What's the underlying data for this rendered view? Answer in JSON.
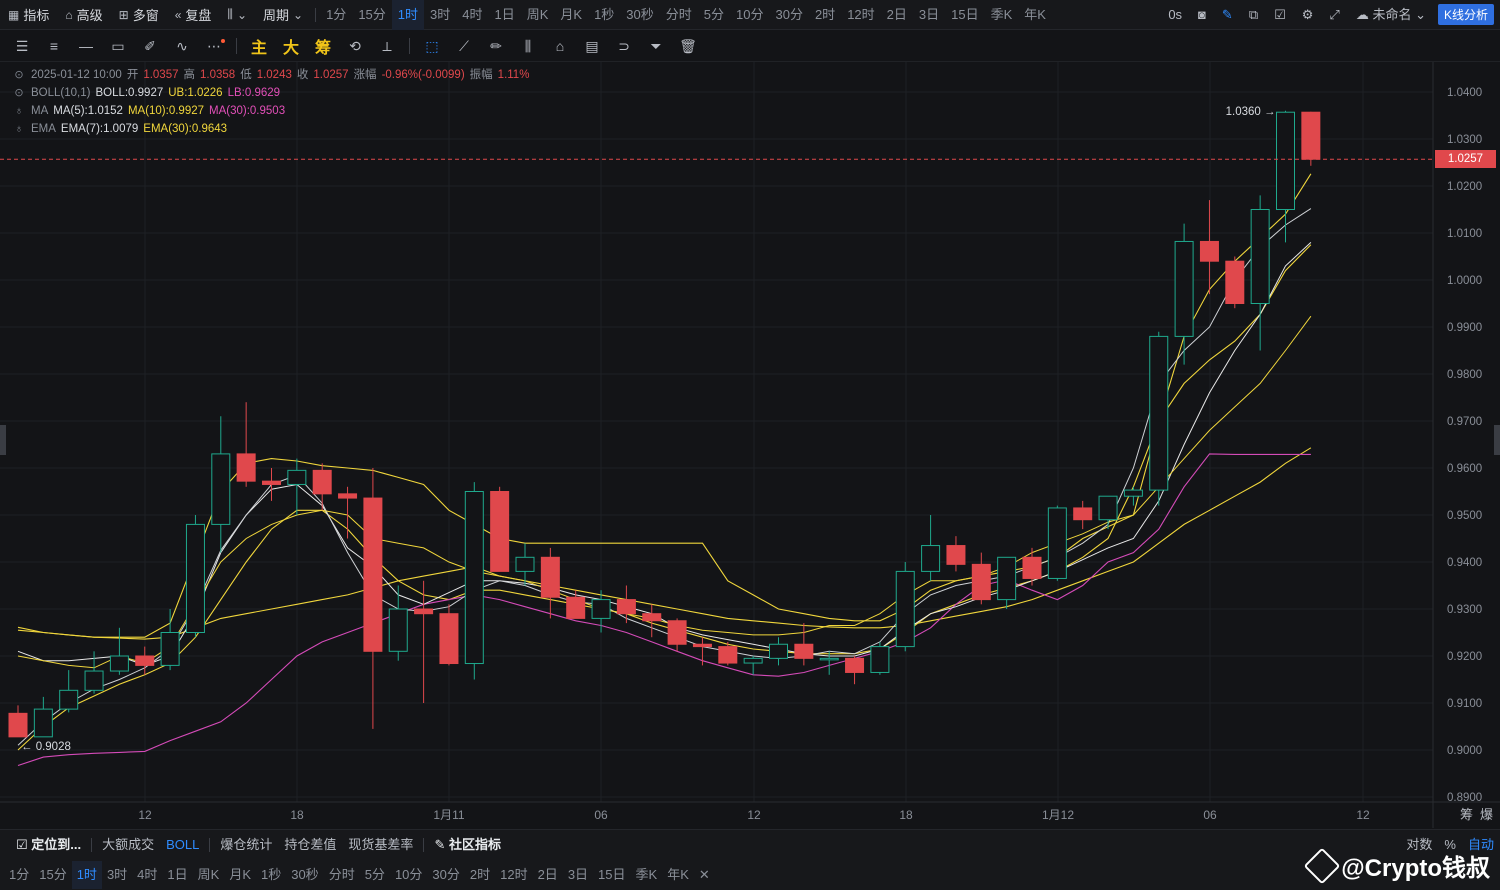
{
  "topbar": {
    "items": [
      {
        "icon": "indicator-icon",
        "label": "指标"
      },
      {
        "icon": "advanced-icon",
        "label": "高级"
      },
      {
        "icon": "multi-window-icon",
        "label": "多窗"
      },
      {
        "icon": "replay-icon",
        "label": "复盘"
      }
    ],
    "chart_type_icon": "candlestick-icon",
    "period_label": "周期",
    "periods": [
      "1分",
      "15分",
      "1时",
      "3时",
      "4时",
      "1日",
      "周K",
      "月K",
      "1秒",
      "30秒",
      "分时",
      "5分",
      "10分",
      "30分",
      "2时",
      "12时",
      "2日",
      "3日",
      "15日",
      "季K",
      "年K"
    ],
    "active_period": "1时",
    "right": {
      "countdown": "0s",
      "layout_name": "未命名",
      "kline_button": "K线分析"
    }
  },
  "drawbar": {
    "tools": [
      "menu-icon",
      "lines-icon",
      "horizontal-line-icon",
      "rectangle-icon",
      "ruler-icon",
      "wave-icon",
      "more-icon"
    ],
    "toggles": [
      "主",
      "大",
      "筹"
    ]
  },
  "legend": {
    "ohlc": {
      "date": "2025-01-12 10:00",
      "open_label": "开",
      "open": "1.0357",
      "high_label": "高",
      "high": "1.0358",
      "low_label": "低",
      "low": "1.0243",
      "close_label": "收",
      "close": "1.0257",
      "change_label": "涨幅",
      "change": "-0.96%(-0.0099)",
      "amp_label": "振幅",
      "amp": "1.11%"
    },
    "boll": {
      "name": "BOLL(10,1)",
      "boll": "BOLL:0.9927",
      "ub": "UB:1.0226",
      "lb": "LB:0.9629"
    },
    "ma": {
      "name": "MA",
      "ma5": "MA(5):1.0152",
      "ma10": "MA(10):0.9927",
      "ma30": "MA(30):0.9503"
    },
    "ema": {
      "name": "EMA",
      "ema7": "EMA(7):1.0079",
      "ema30": "EMA(30):0.9643"
    }
  },
  "price_axis": [
    "1.0400",
    "1.0300",
    "1.0200",
    "1.0100",
    "1.0000",
    "0.9900",
    "0.9800",
    "0.9700",
    "0.9600",
    "0.9500",
    "0.9400",
    "0.9300",
    "0.9200",
    "0.9100",
    "0.9000",
    "0.8900"
  ],
  "time_axis": [
    "12",
    "18",
    "1月11",
    "06",
    "12",
    "18",
    "1月12",
    "06",
    "12"
  ],
  "current_price": "1.0257",
  "high_marker": "1.0360",
  "low_marker": "0.9028",
  "colors": {
    "up": "#1fa98d",
    "down": "#e0484c",
    "boll_mid": "#e8e8e8",
    "ma_yellow": "#f0d63c",
    "ma_pink": "#d44bb8",
    "accent": "#2f8cff"
  },
  "chart_data": {
    "type": "candlestick",
    "ylim": [
      0.89,
      1.04
    ],
    "candles": [
      [
        0.9078,
        0.9095,
        0.9028,
        0.9028
      ],
      [
        0.9028,
        0.9113,
        0.9028,
        0.9087
      ],
      [
        0.9087,
        0.917,
        0.908,
        0.9127
      ],
      [
        0.9127,
        0.921,
        0.912,
        0.9168
      ],
      [
        0.9168,
        0.926,
        0.916,
        0.92
      ],
      [
        0.92,
        0.922,
        0.916,
        0.918
      ],
      [
        0.918,
        0.93,
        0.917,
        0.925
      ],
      [
        0.925,
        0.95,
        0.924,
        0.948
      ],
      [
        0.948,
        0.971,
        0.942,
        0.963
      ],
      [
        0.963,
        0.974,
        0.956,
        0.9572
      ],
      [
        0.9572,
        0.96,
        0.953,
        0.9565
      ],
      [
        0.9565,
        0.962,
        0.95,
        0.9595
      ],
      [
        0.9595,
        0.961,
        0.951,
        0.9545
      ],
      [
        0.9545,
        0.956,
        0.945,
        0.9536
      ],
      [
        0.9536,
        0.96,
        0.9045,
        0.921
      ],
      [
        0.921,
        0.935,
        0.919,
        0.93
      ],
      [
        0.93,
        0.936,
        0.91,
        0.929
      ],
      [
        0.929,
        0.931,
        0.918,
        0.9184
      ],
      [
        0.9184,
        0.957,
        0.915,
        0.955
      ],
      [
        0.955,
        0.956,
        0.94,
        0.938
      ],
      [
        0.938,
        0.944,
        0.935,
        0.941
      ],
      [
        0.941,
        0.943,
        0.928,
        0.9325
      ],
      [
        0.9325,
        0.934,
        0.928,
        0.928
      ],
      [
        0.928,
        0.934,
        0.925,
        0.932
      ],
      [
        0.932,
        0.935,
        0.927,
        0.929
      ],
      [
        0.929,
        0.931,
        0.924,
        0.9275
      ],
      [
        0.9275,
        0.928,
        0.921,
        0.9225
      ],
      [
        0.9225,
        0.924,
        0.918,
        0.922
      ],
      [
        0.922,
        0.923,
        0.918,
        0.9185
      ],
      [
        0.9185,
        0.92,
        0.916,
        0.9195
      ],
      [
        0.9195,
        0.924,
        0.918,
        0.9225
      ],
      [
        0.9225,
        0.927,
        0.918,
        0.9195
      ],
      [
        0.9195,
        0.921,
        0.916,
        0.9195
      ],
      [
        0.9195,
        0.92,
        0.914,
        0.9165
      ],
      [
        0.9165,
        0.923,
        0.916,
        0.922
      ],
      [
        0.922,
        0.94,
        0.921,
        0.938
      ],
      [
        0.938,
        0.95,
        0.936,
        0.9435
      ],
      [
        0.9435,
        0.9455,
        0.938,
        0.9395
      ],
      [
        0.9395,
        0.942,
        0.931,
        0.932
      ],
      [
        0.932,
        0.941,
        0.93,
        0.941
      ],
      [
        0.941,
        0.943,
        0.935,
        0.9365
      ],
      [
        0.9365,
        0.952,
        0.936,
        0.9515
      ],
      [
        0.9515,
        0.953,
        0.947,
        0.949
      ],
      [
        0.949,
        0.954,
        0.947,
        0.954
      ],
      [
        0.954,
        0.956,
        0.952,
        0.9553
      ],
      [
        0.9553,
        0.989,
        0.952,
        0.988
      ],
      [
        0.988,
        1.012,
        0.982,
        1.0082
      ],
      [
        1.0082,
        1.017,
        0.997,
        1.004
      ],
      [
        1.004,
        1.005,
        0.994,
        0.995
      ],
      [
        0.995,
        1.018,
        0.985,
        1.015
      ],
      [
        1.015,
        1.036,
        1.008,
        1.0357
      ],
      [
        1.0357,
        1.0358,
        1.0243,
        1.0257
      ]
    ],
    "boll_mid": [
      0.921,
      0.919,
      0.919,
      0.9195,
      0.92,
      0.918,
      0.92,
      0.929,
      0.942,
      0.95,
      0.9555,
      0.9565,
      0.952,
      0.943,
      0.939,
      0.933,
      0.931,
      0.9335,
      0.936,
      0.936,
      0.9355,
      0.9345,
      0.933,
      0.932,
      0.9305,
      0.929,
      0.926,
      0.9245,
      0.9235,
      0.9225,
      0.9215,
      0.9205,
      0.92,
      0.92,
      0.9215,
      0.9255,
      0.929,
      0.9305,
      0.9325,
      0.934,
      0.936,
      0.938,
      0.9405,
      0.943,
      0.945,
      0.953,
      0.965,
      0.976,
      0.985,
      0.9927,
      1.003,
      1.008
    ],
    "boll_ub": [
      0.9255,
      0.925,
      0.9245,
      0.924,
      0.924,
      0.924,
      0.927,
      0.941,
      0.955,
      0.961,
      0.962,
      0.9615,
      0.9605,
      0.96,
      0.9595,
      0.958,
      0.9565,
      0.951,
      0.948,
      0.945,
      0.944,
      0.944,
      0.944,
      0.944,
      0.944,
      0.944,
      0.944,
      0.944,
      0.936,
      0.933,
      0.93,
      0.929,
      0.928,
      0.9275,
      0.9275,
      0.93,
      0.934,
      0.936,
      0.937,
      0.938,
      0.939,
      0.941,
      0.945,
      0.9475,
      0.95,
      0.97,
      0.988,
      0.998,
      1.004,
      1.009,
      1.014,
      1.0226
    ],
    "boll_lb": [
      0.917,
      0.915,
      0.913,
      0.913,
      0.915,
      0.914,
      0.915,
      0.918,
      0.926,
      0.936,
      0.944,
      0.948,
      0.947,
      0.941,
      0.938,
      0.935,
      0.932,
      0.93,
      0.929,
      0.928,
      0.927,
      0.927,
      0.926,
      0.925,
      0.924,
      0.923,
      0.9215,
      0.921,
      0.921,
      0.9205,
      0.92,
      0.9195,
      0.919,
      0.92,
      0.924,
      0.928,
      0.929,
      0.93,
      0.9305,
      0.931,
      0.932,
      0.934,
      0.936,
      0.937,
      0.939,
      0.947,
      0.957,
      0.965,
      0.972,
      0.978,
      0.986,
      0.9629
    ],
    "ma5": [
      0.901,
      0.906,
      0.91,
      0.913,
      0.915,
      0.9175,
      0.9215,
      0.9305,
      0.9425,
      0.95,
      0.9565,
      0.9585,
      0.9525,
      0.942,
      0.933,
      0.93,
      0.9295,
      0.9305,
      0.934,
      0.936,
      0.935,
      0.933,
      0.9315,
      0.931,
      0.928,
      0.926,
      0.924,
      0.922,
      0.921,
      0.92,
      0.9195,
      0.92,
      0.921,
      0.9205,
      0.923,
      0.929,
      0.933,
      0.935,
      0.936,
      0.937,
      0.939,
      0.941,
      0.944,
      0.948,
      0.96,
      0.978,
      0.985,
      0.99,
      1.0,
      1.007,
      1.0117,
      1.0152
    ],
    "ma10": [
      0.9,
      0.905,
      0.909,
      0.9115,
      0.914,
      0.916,
      0.9185,
      0.924,
      0.932,
      0.94,
      0.947,
      0.951,
      0.951,
      0.947,
      0.941,
      0.936,
      0.933,
      0.932,
      0.934,
      0.934,
      0.933,
      0.932,
      0.931,
      0.93,
      0.929,
      0.927,
      0.9255,
      0.924,
      0.9225,
      0.9215,
      0.921,
      0.9205,
      0.9205,
      0.9205,
      0.9215,
      0.925,
      0.929,
      0.931,
      0.933,
      0.9345,
      0.936,
      0.938,
      0.941,
      0.945,
      0.956,
      0.97,
      0.978,
      0.983,
      0.987,
      0.9927,
      1.002,
      1.0075
    ],
    "ma30": [
      0.8967,
      0.8985,
      0.899,
      0.8993,
      0.8995,
      0.8997,
      0.902,
      0.904,
      0.906,
      0.91,
      0.915,
      0.92,
      0.923,
      0.925,
      0.927,
      0.929,
      0.931,
      0.932,
      0.933,
      0.932,
      0.9305,
      0.929,
      0.9275,
      0.9265,
      0.925,
      0.923,
      0.921,
      0.919,
      0.9175,
      0.916,
      0.9157,
      0.9165,
      0.918,
      0.9195,
      0.921,
      0.923,
      0.926,
      0.931,
      0.935,
      0.9362,
      0.934,
      0.932,
      0.935,
      0.94,
      0.942,
      0.947,
      0.956,
      0.963,
      0.9629,
      0.9629,
      0.9629,
      0.9629
    ],
    "ema7": [
      0.92,
      0.919,
      0.918,
      0.9175,
      0.92,
      0.9185,
      0.922,
      0.931,
      0.94,
      0.945,
      0.948,
      0.95,
      0.951,
      0.95,
      0.945,
      0.944,
      0.943,
      0.94,
      0.938,
      0.937,
      0.936,
      0.934,
      0.932,
      0.93,
      0.929,
      0.928,
      0.9265,
      0.9255,
      0.925,
      0.9245,
      0.9245,
      0.925,
      0.9265,
      0.9265,
      0.929,
      0.933,
      0.936,
      0.936,
      0.937,
      0.939,
      0.942,
      0.944,
      0.946,
      0.9485,
      0.95,
      0.956,
      0.962,
      0.968,
      0.973,
      0.978,
      0.985,
      0.9923
    ],
    "ema30": [
      0.9261,
      0.925,
      0.9245,
      0.924,
      0.9238,
      0.9236,
      0.924,
      0.926,
      0.928,
      0.929,
      0.93,
      0.931,
      0.932,
      0.933,
      0.9345,
      0.936,
      0.937,
      0.938,
      0.939,
      0.937,
      0.936,
      0.935,
      0.934,
      0.933,
      0.932,
      0.931,
      0.93,
      0.929,
      0.928,
      0.9275,
      0.927,
      0.9265,
      0.9262,
      0.926,
      0.926,
      0.9265,
      0.9275,
      0.9285,
      0.9295,
      0.9305,
      0.932,
      0.934,
      0.936,
      0.938,
      0.94,
      0.944,
      0.948,
      0.951,
      0.954,
      0.957,
      0.961,
      0.9643
    ]
  },
  "bottom1": {
    "locate": "定位到...",
    "items": [
      "大额成交",
      "BOLL"
    ],
    "items2": [
      "爆仓统计",
      "持仓差值",
      "现货基差率"
    ],
    "community": "社区指标",
    "right": [
      "对数",
      "%",
      "自动"
    ]
  },
  "bottom2": {
    "periods": [
      "1分",
      "15分",
      "1时",
      "3时",
      "4时",
      "1日",
      "周K",
      "月K",
      "1秒",
      "30秒",
      "分时",
      "5分",
      "10分",
      "30分",
      "2时",
      "12时",
      "2日",
      "3日",
      "15日",
      "季K",
      "年K"
    ],
    "active": "1时"
  },
  "watermark": "@Crypto钱叔",
  "right_axis_toggles": [
    "筹",
    "爆"
  ]
}
